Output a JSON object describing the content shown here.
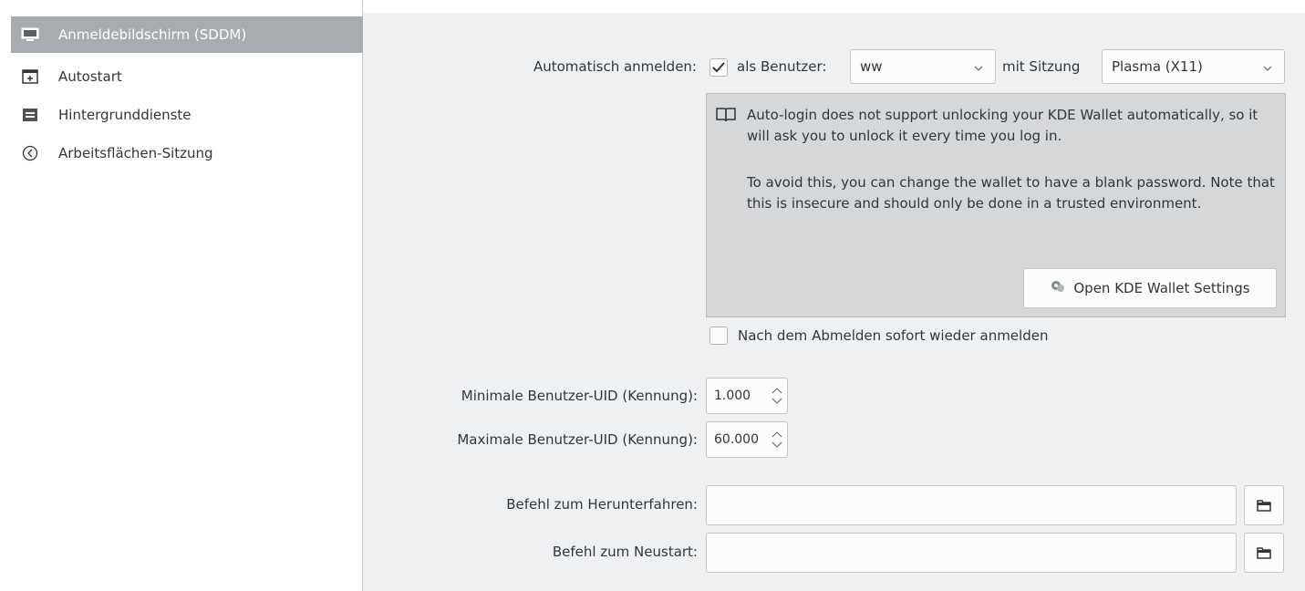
{
  "sidebar": {
    "items": [
      {
        "label": "Anmeldebildschirm (SDDM)",
        "icon": "monitor-icon",
        "selected": true
      },
      {
        "label": "Autostart",
        "icon": "autostart-icon",
        "selected": false
      },
      {
        "label": "Hintergrunddienste",
        "icon": "services-icon",
        "selected": false
      },
      {
        "label": "Arbeitsflächen-Sitzung",
        "icon": "session-icon",
        "selected": false
      }
    ]
  },
  "autologin": {
    "label": "Automatisch anmelden:",
    "checked": true,
    "user_label": "als Benutzer:",
    "user_value": "ww",
    "session_label": "mit Sitzung",
    "session_value": "Plasma (X11)"
  },
  "info": {
    "line1": "Auto-login does not support unlocking your KDE Wallet automatically, so it will ask you to unlock it every time you log in.",
    "line2": "To avoid this, you can change the wallet to have a blank password. Note that this is insecure and should only be done in a trusted environment.",
    "button": "Open KDE Wallet Settings"
  },
  "relogin": {
    "label": "Nach dem Abmelden sofort wieder anmelden",
    "checked": false
  },
  "uid": {
    "min_label": "Minimale Benutzer-UID (Kennung):",
    "min_value": "1.000",
    "max_label": "Maximale Benutzer-UID (Kennung):",
    "max_value": "60.000"
  },
  "commands": {
    "halt_label": "Befehl zum Herunterfahren:",
    "halt_value": "",
    "reboot_label": "Befehl zum Neustart:",
    "reboot_value": ""
  },
  "colors": {
    "selection": "#a8abaf",
    "window_bg": "#eff0f1",
    "info_bg": "#d6d7d8"
  }
}
